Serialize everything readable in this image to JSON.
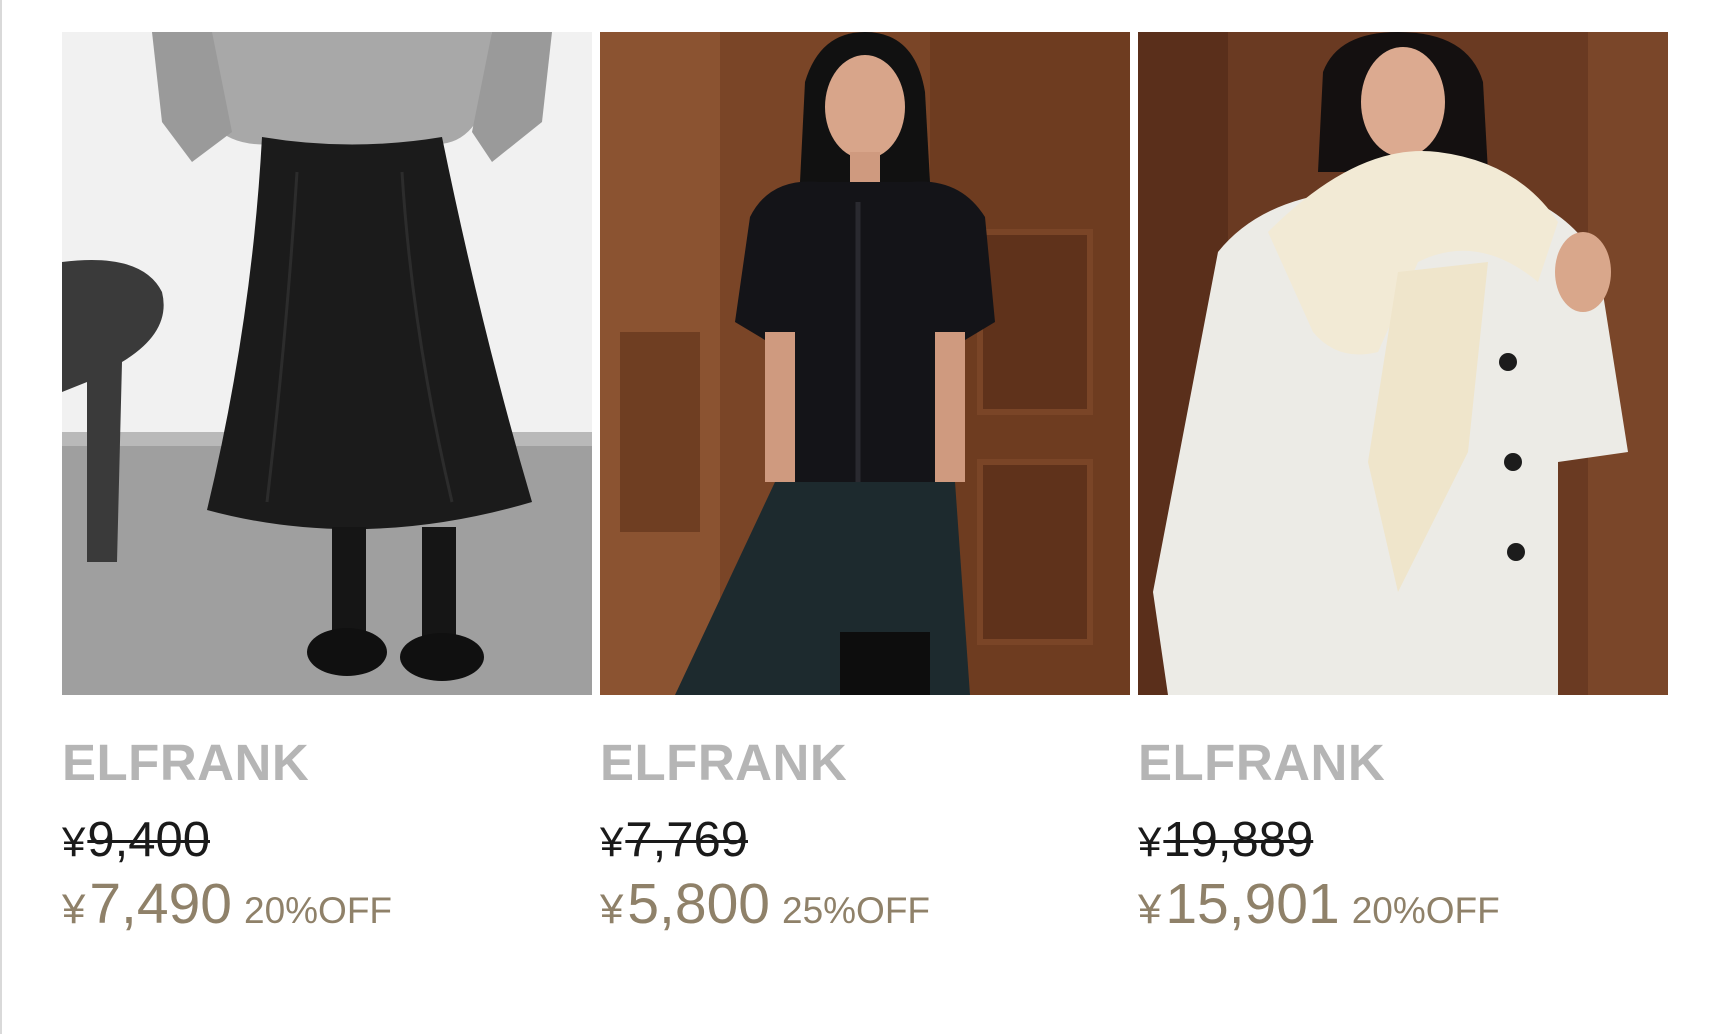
{
  "products": [
    {
      "brand": "ELFRANK",
      "currency": "¥",
      "original_price": "9,400",
      "sale_price": "7,490",
      "discount": "20%OFF",
      "image": "black-flared-skirt-photo"
    },
    {
      "brand": "ELFRANK",
      "currency": "¥",
      "original_price": "7,769",
      "sale_price": "5,800",
      "discount": "25%OFF",
      "image": "black-velvet-puff-sleeve-top-photo"
    },
    {
      "brand": "ELFRANK",
      "currency": "¥",
      "original_price": "19,889",
      "sale_price": "15,901",
      "discount": "20%OFF",
      "image": "white-wool-jacket-with-knit-scarf-photo"
    }
  ],
  "colors": {
    "brand_text": "#b5b5b5",
    "original_price_text": "#1a1a1a",
    "sale_price_text": "#8f8169"
  }
}
